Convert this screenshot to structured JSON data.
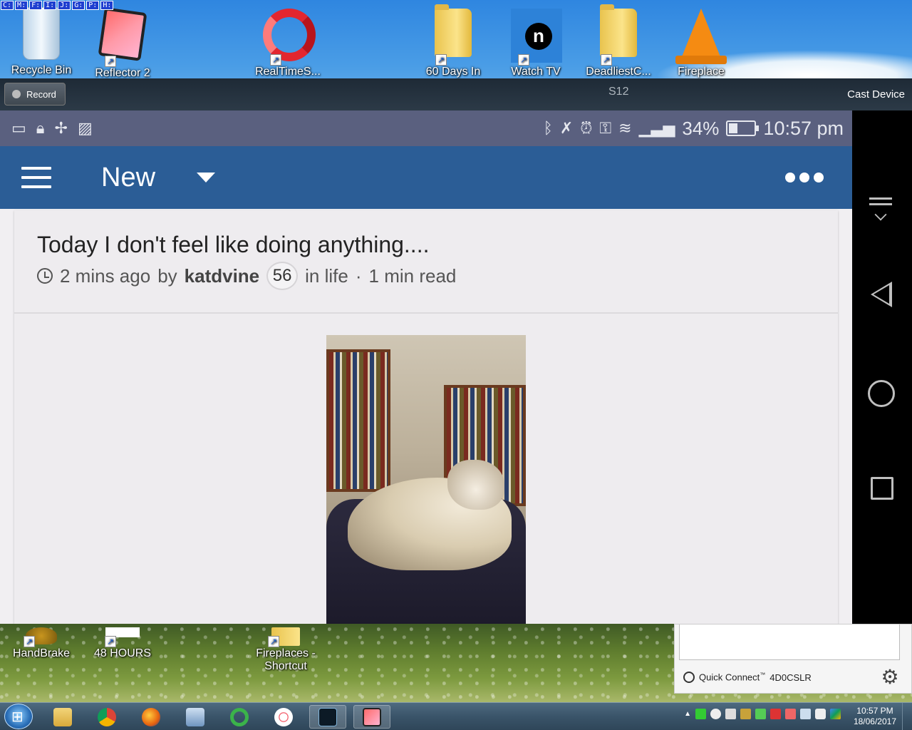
{
  "drives": [
    "C:",
    "M:",
    "F:",
    "I:",
    "J:",
    "G:",
    "P:",
    "H:"
  ],
  "desktop_top_icons": [
    {
      "label": "Recycle Bin"
    },
    {
      "label": "Reflector 2"
    },
    {
      "label": "RealTimeS..."
    },
    {
      "label": "60 Days In"
    },
    {
      "label": "Watch TV"
    },
    {
      "label": "DeadliestC..."
    },
    {
      "label": "Fireplace"
    }
  ],
  "overlapped_label": "S12",
  "record_bar": {
    "record_label": "Record",
    "cast_label": "Cast Device"
  },
  "phone": {
    "status": {
      "battery_pct": "34%",
      "battery_level": 0.34,
      "time": "10:57 pm"
    },
    "app_bar": {
      "feed_title": "New"
    },
    "post": {
      "title": "Today I don't feel like doing anything....",
      "age": "2 mins ago",
      "by": "by",
      "author": "katdvine",
      "reputation": "56",
      "category": "in life",
      "separator": "·",
      "read_time": "1 min read"
    }
  },
  "desktop_bottom_icons": [
    {
      "label": "HandBrake"
    },
    {
      "label": "48 HOURS"
    },
    {
      "label": "Fireplaces - Shortcut"
    }
  ],
  "quick_connect": {
    "label": "Quick Connect",
    "tm": "™",
    "device": "4D0CSLR"
  },
  "taskbar": {
    "time": "10:57 PM",
    "date": "18/06/2017"
  }
}
